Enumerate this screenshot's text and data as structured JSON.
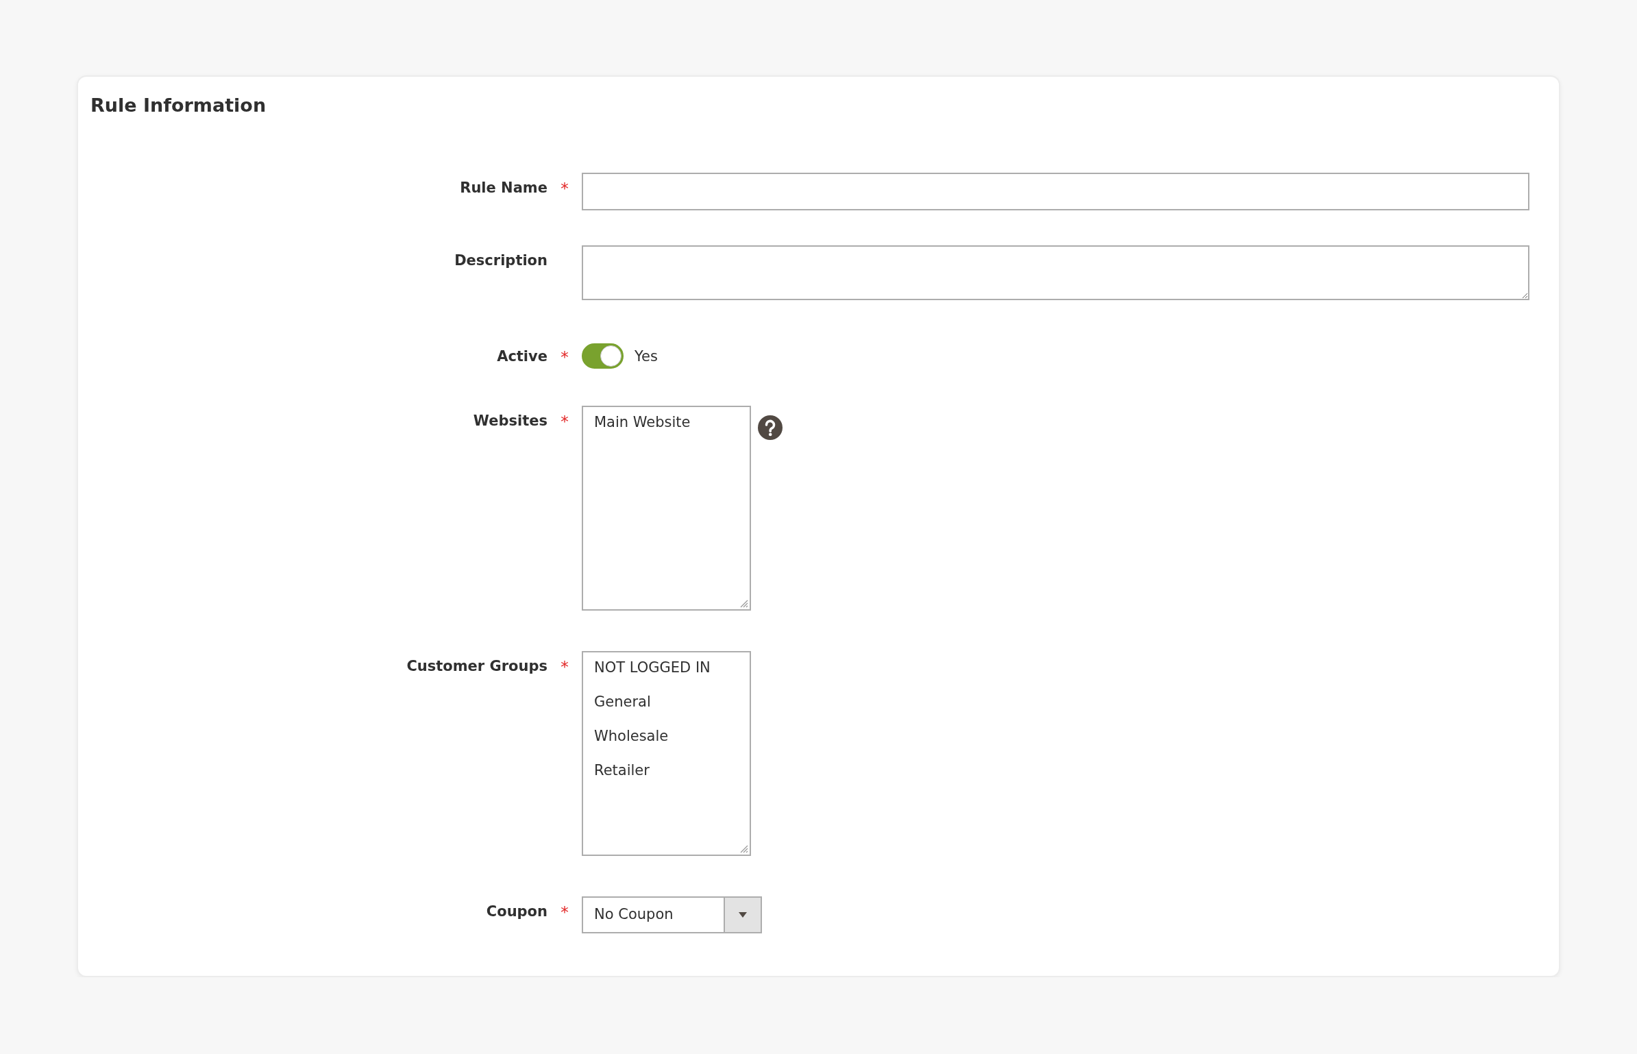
{
  "panel": {
    "title": "Rule Information"
  },
  "fields": [
    {
      "kind": "text",
      "label": "Rule Name",
      "required_mark": "*"
    },
    {
      "kind": "textarea",
      "label": "Description"
    },
    {
      "kind": "toggle",
      "label": "Active",
      "required_mark": "*",
      "on": true,
      "value": "Yes"
    },
    {
      "kind": "multiselect",
      "label": "Websites",
      "required_mark": "*",
      "help": true,
      "options": [
        "Main Website"
      ]
    },
    {
      "kind": "multiselect",
      "label": "Customer Groups",
      "required_mark": "*",
      "options": [
        "NOT LOGGED IN",
        "General",
        "Wholesale",
        "Retailer"
      ]
    },
    {
      "kind": "select",
      "label": "Coupon",
      "required_mark": "*",
      "value": "No Coupon"
    }
  ]
}
